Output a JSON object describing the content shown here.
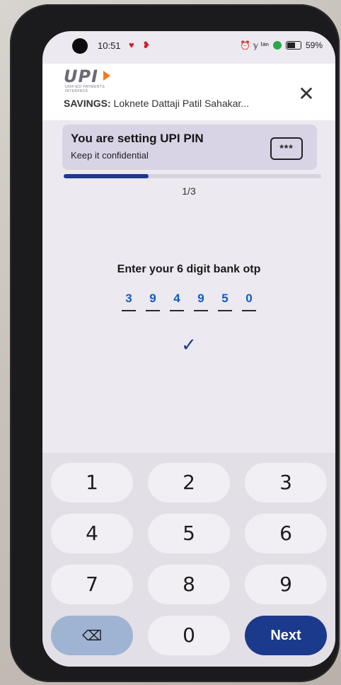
{
  "status_bar": {
    "time": "10:51",
    "left_icons": "♥ ❥",
    "right_icons": "⏰ 𝕪 ᵗᵃⁿ",
    "battery": "59%"
  },
  "header": {
    "logo_text": "UPI",
    "logo_subtitle": "UNIFIED PAYMENTS INTERFACE",
    "account_type": "SAVINGS:",
    "bank_name": "Loknete Dattaji Patil Sahakar...",
    "close_icon": "✕"
  },
  "pin_card": {
    "title": "You are setting UPI PIN",
    "subtitle": "Keep it confidential",
    "icon_text": "***"
  },
  "progress": {
    "fraction": 0.33,
    "step_label": "1/3"
  },
  "otp": {
    "label": "Enter your 6 digit bank otp",
    "digits": [
      "3",
      "9",
      "4",
      "9",
      "5",
      "0"
    ]
  },
  "check_icon": "✓",
  "keypad": {
    "keys": [
      "1",
      "2",
      "3",
      "4",
      "5",
      "6",
      "7",
      "8",
      "9"
    ],
    "zero": "0",
    "backspace": "⌫",
    "next": "Next"
  },
  "colors": {
    "primary": "#1b3a8c",
    "card_bg": "#d8d4e6",
    "otp_digit": "#0f5bc4"
  }
}
